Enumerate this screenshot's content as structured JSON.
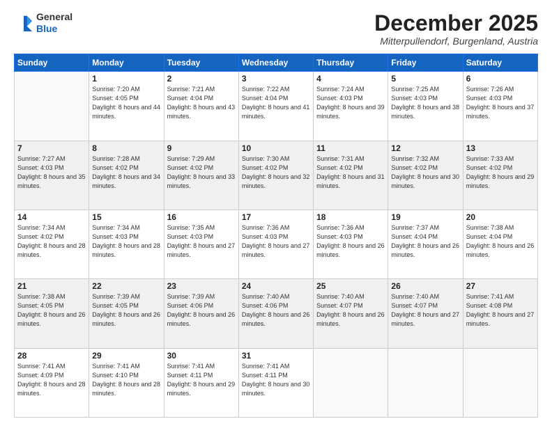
{
  "logo": {
    "line1": "General",
    "line2": "Blue"
  },
  "title": "December 2025",
  "location": "Mitterpullendorf, Burgenland, Austria",
  "weekdays": [
    "Sunday",
    "Monday",
    "Tuesday",
    "Wednesday",
    "Thursday",
    "Friday",
    "Saturday"
  ],
  "days": [
    {
      "date": "",
      "sunrise": "",
      "sunset": "",
      "daylight": ""
    },
    {
      "date": "1",
      "sunrise": "7:20 AM",
      "sunset": "4:05 PM",
      "daylight": "8 hours and 44 minutes."
    },
    {
      "date": "2",
      "sunrise": "7:21 AM",
      "sunset": "4:04 PM",
      "daylight": "8 hours and 43 minutes."
    },
    {
      "date": "3",
      "sunrise": "7:22 AM",
      "sunset": "4:04 PM",
      "daylight": "8 hours and 41 minutes."
    },
    {
      "date": "4",
      "sunrise": "7:24 AM",
      "sunset": "4:03 PM",
      "daylight": "8 hours and 39 minutes."
    },
    {
      "date": "5",
      "sunrise": "7:25 AM",
      "sunset": "4:03 PM",
      "daylight": "8 hours and 38 minutes."
    },
    {
      "date": "6",
      "sunrise": "7:26 AM",
      "sunset": "4:03 PM",
      "daylight": "8 hours and 37 minutes."
    },
    {
      "date": "7",
      "sunrise": "7:27 AM",
      "sunset": "4:03 PM",
      "daylight": "8 hours and 35 minutes."
    },
    {
      "date": "8",
      "sunrise": "7:28 AM",
      "sunset": "4:02 PM",
      "daylight": "8 hours and 34 minutes."
    },
    {
      "date": "9",
      "sunrise": "7:29 AM",
      "sunset": "4:02 PM",
      "daylight": "8 hours and 33 minutes."
    },
    {
      "date": "10",
      "sunrise": "7:30 AM",
      "sunset": "4:02 PM",
      "daylight": "8 hours and 32 minutes."
    },
    {
      "date": "11",
      "sunrise": "7:31 AM",
      "sunset": "4:02 PM",
      "daylight": "8 hours and 31 minutes."
    },
    {
      "date": "12",
      "sunrise": "7:32 AM",
      "sunset": "4:02 PM",
      "daylight": "8 hours and 30 minutes."
    },
    {
      "date": "13",
      "sunrise": "7:33 AM",
      "sunset": "4:02 PM",
      "daylight": "8 hours and 29 minutes."
    },
    {
      "date": "14",
      "sunrise": "7:34 AM",
      "sunset": "4:02 PM",
      "daylight": "8 hours and 28 minutes."
    },
    {
      "date": "15",
      "sunrise": "7:34 AM",
      "sunset": "4:03 PM",
      "daylight": "8 hours and 28 minutes."
    },
    {
      "date": "16",
      "sunrise": "7:35 AM",
      "sunset": "4:03 PM",
      "daylight": "8 hours and 27 minutes."
    },
    {
      "date": "17",
      "sunrise": "7:36 AM",
      "sunset": "4:03 PM",
      "daylight": "8 hours and 27 minutes."
    },
    {
      "date": "18",
      "sunrise": "7:36 AM",
      "sunset": "4:03 PM",
      "daylight": "8 hours and 26 minutes."
    },
    {
      "date": "19",
      "sunrise": "7:37 AM",
      "sunset": "4:04 PM",
      "daylight": "8 hours and 26 minutes."
    },
    {
      "date": "20",
      "sunrise": "7:38 AM",
      "sunset": "4:04 PM",
      "daylight": "8 hours and 26 minutes."
    },
    {
      "date": "21",
      "sunrise": "7:38 AM",
      "sunset": "4:05 PM",
      "daylight": "8 hours and 26 minutes."
    },
    {
      "date": "22",
      "sunrise": "7:39 AM",
      "sunset": "4:05 PM",
      "daylight": "8 hours and 26 minutes."
    },
    {
      "date": "23",
      "sunrise": "7:39 AM",
      "sunset": "4:06 PM",
      "daylight": "8 hours and 26 minutes."
    },
    {
      "date": "24",
      "sunrise": "7:40 AM",
      "sunset": "4:06 PM",
      "daylight": "8 hours and 26 minutes."
    },
    {
      "date": "25",
      "sunrise": "7:40 AM",
      "sunset": "4:07 PM",
      "daylight": "8 hours and 26 minutes."
    },
    {
      "date": "26",
      "sunrise": "7:40 AM",
      "sunset": "4:07 PM",
      "daylight": "8 hours and 27 minutes."
    },
    {
      "date": "27",
      "sunrise": "7:41 AM",
      "sunset": "4:08 PM",
      "daylight": "8 hours and 27 minutes."
    },
    {
      "date": "28",
      "sunrise": "7:41 AM",
      "sunset": "4:09 PM",
      "daylight": "8 hours and 28 minutes."
    },
    {
      "date": "29",
      "sunrise": "7:41 AM",
      "sunset": "4:10 PM",
      "daylight": "8 hours and 28 minutes."
    },
    {
      "date": "30",
      "sunrise": "7:41 AM",
      "sunset": "4:11 PM",
      "daylight": "8 hours and 29 minutes."
    },
    {
      "date": "31",
      "sunrise": "7:41 AM",
      "sunset": "4:11 PM",
      "daylight": "8 hours and 30 minutes."
    }
  ]
}
